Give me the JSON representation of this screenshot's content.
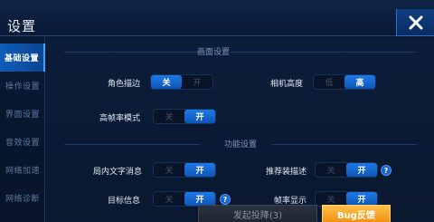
{
  "title": "设置",
  "sidebar": {
    "items": [
      {
        "label": "基础设置",
        "active": true
      },
      {
        "label": "操作设置",
        "active": false
      },
      {
        "label": "界面设置",
        "active": false
      },
      {
        "label": "音效设置",
        "active": false
      },
      {
        "label": "网络加速",
        "active": false
      },
      {
        "label": "网络诊断",
        "active": false
      }
    ]
  },
  "sections": {
    "display": {
      "title": "画面设置"
    },
    "function": {
      "title": "功能设置"
    }
  },
  "settings": {
    "outline": {
      "label": "角色描边",
      "left": "关",
      "right": "开",
      "selected": "left"
    },
    "camera": {
      "label": "相机高度",
      "left": "低",
      "right": "高",
      "selected": "right"
    },
    "hfr": {
      "label": "高帧率模式",
      "left": "关",
      "right": "开",
      "selected": "right"
    },
    "ingame_text": {
      "label": "局内文字消息",
      "left": "关",
      "right": "开",
      "selected": "right"
    },
    "recommend": {
      "label": "推荐装描述",
      "left": "关",
      "right": "开",
      "selected": "right"
    },
    "target_info": {
      "label": "目标信息",
      "left": "关",
      "right": "开",
      "selected": "right"
    },
    "fps_display": {
      "label": "帧率显示",
      "left": "关",
      "right": "开",
      "selected": "right"
    }
  },
  "bottom": {
    "surrender_label": "发起投降(3)",
    "bug_label": "Bug反馈"
  },
  "colors": {
    "accent": "#1d79e6",
    "bug_button": "#f19212",
    "background": "#0a1830"
  },
  "icons": {
    "close": "close-x-icon",
    "help": "question-mark-icon"
  }
}
